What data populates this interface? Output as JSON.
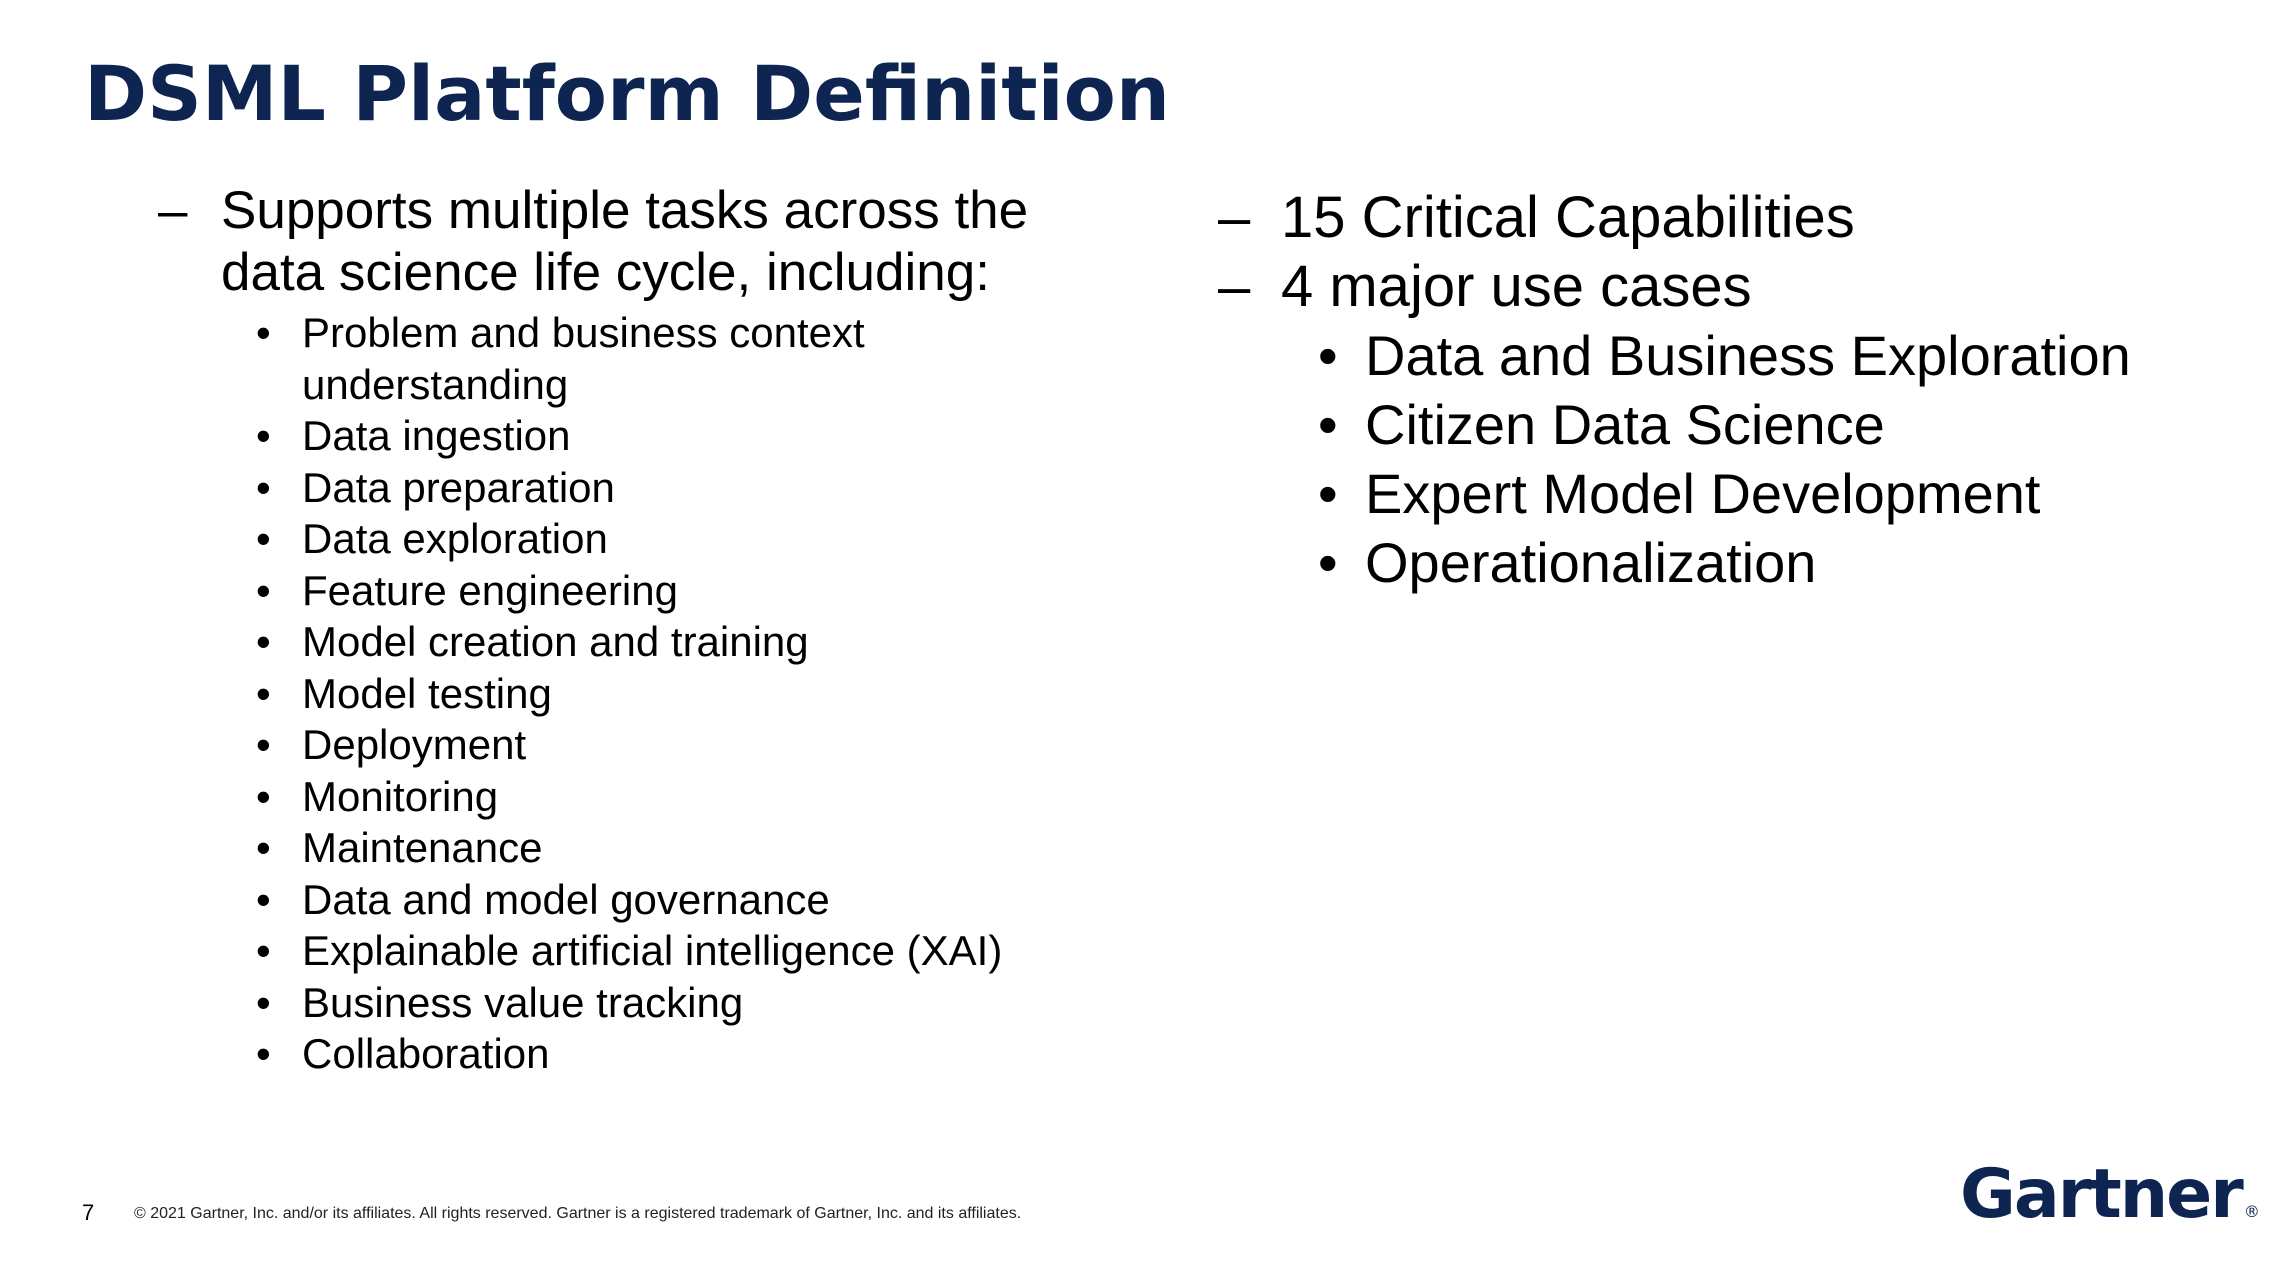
{
  "title": "DSML Platform Definition",
  "left": {
    "dash_symbol": "–",
    "bullet_symbol": "•",
    "heading": "Supports multiple tasks across the data science life cycle, including:",
    "items": [
      "Problem and business context understanding",
      "Data ingestion",
      "Data preparation",
      "Data exploration",
      "Feature engineering",
      "Model creation and training",
      "Model testing",
      "Deployment",
      "Monitoring",
      "Maintenance",
      "Data and model governance",
      "Explainable artificial intelligence (XAI)",
      "Business value tracking",
      "Collaboration"
    ]
  },
  "right": {
    "dash_symbol": "–",
    "bullet_symbol": "•",
    "points": [
      "15 Critical Capabilities",
      "4 major use cases"
    ],
    "use_cases": [
      "Data and Business Exploration",
      "Citizen Data Science",
      "Expert Model Development",
      "Operationalization"
    ]
  },
  "footer": {
    "page_number": "7",
    "copyright": "© 2021 Gartner, Inc. and/or its affiliates. All rights reserved. Gartner is a registered trademark of Gartner, Inc. and its affiliates."
  },
  "logo": {
    "text": "Gartner",
    "mark": "®",
    "color": "#0e2451"
  },
  "colors": {
    "title": "#0e2451",
    "text": "#000000",
    "background": "#ffffff"
  }
}
